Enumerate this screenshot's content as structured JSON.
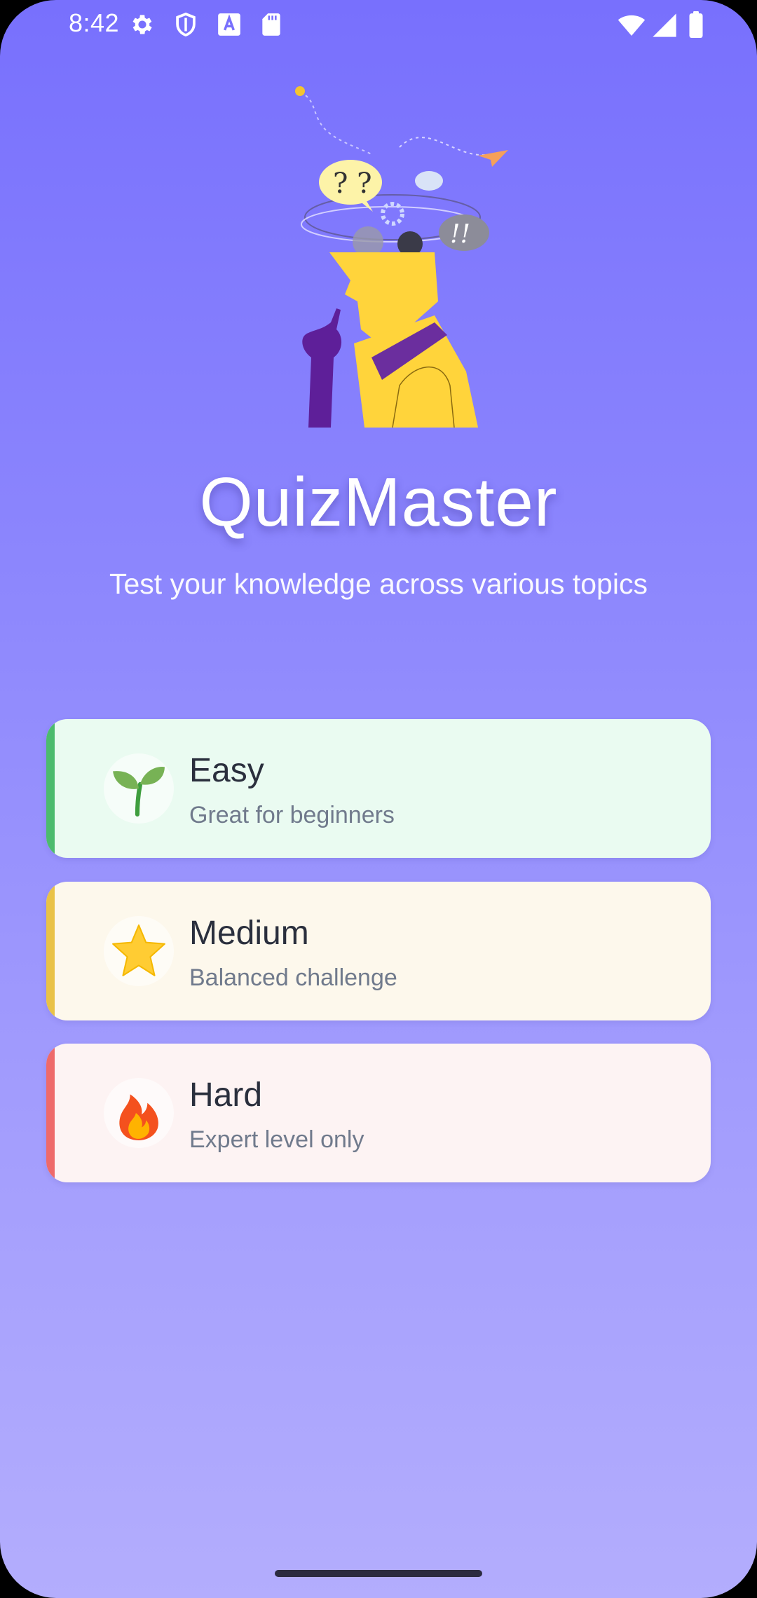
{
  "status_bar": {
    "time": "8:42",
    "icons": [
      "settings-icon",
      "shield-icon",
      "font-a-icon",
      "sd-card-icon",
      "wifi-icon",
      "cell-signal-icon",
      "battery-icon"
    ]
  },
  "app": {
    "title": "QuizMaster",
    "subtitle": "Test your knowledge across various topics",
    "illustration_icon": "thinking-person-illustration",
    "illustration_text": "? ? ! !"
  },
  "difficulties": [
    {
      "title": "Easy",
      "description": "Great for beginners",
      "icon": "seedling-icon",
      "accent": "#4CBB6E",
      "background": "#EAFBF1"
    },
    {
      "title": "Medium",
      "description": "Balanced challenge",
      "icon": "star-icon",
      "accent": "#E9C247",
      "background": "#FDF8EC"
    },
    {
      "title": "Hard",
      "description": "Expert level only",
      "icon": "fire-icon",
      "accent": "#EE6A6A",
      "background": "#FDF3F3"
    }
  ],
  "colors": {
    "gradient_top": "#7870FD",
    "gradient_bottom": "#B3ADFD",
    "text_primary": "#2a2f3d",
    "text_secondary": "#707a8c"
  }
}
